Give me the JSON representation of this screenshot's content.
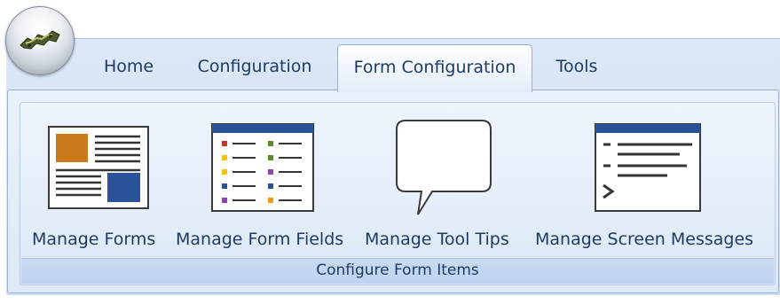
{
  "ribbon": {
    "tabs": [
      {
        "label": "Home"
      },
      {
        "label": "Configuration"
      },
      {
        "label": "Form Configuration"
      },
      {
        "label": "Tools"
      }
    ],
    "active_tab": "Form Configuration",
    "group": {
      "caption": "Configure Form Items",
      "buttons": [
        {
          "label": "Manage Forms",
          "icon": "forms-layout-icon"
        },
        {
          "label": "Manage Form Fields",
          "icon": "form-fields-list-icon"
        },
        {
          "label": "Manage Tool Tips",
          "icon": "speech-bubble-icon"
        },
        {
          "label": "Manage Screen Messages",
          "icon": "console-messages-icon"
        }
      ]
    }
  },
  "colors": {
    "accent_blue": "#2a5298",
    "orange": "#c97a1a",
    "ribbon_bg": "#dbe8f8"
  }
}
